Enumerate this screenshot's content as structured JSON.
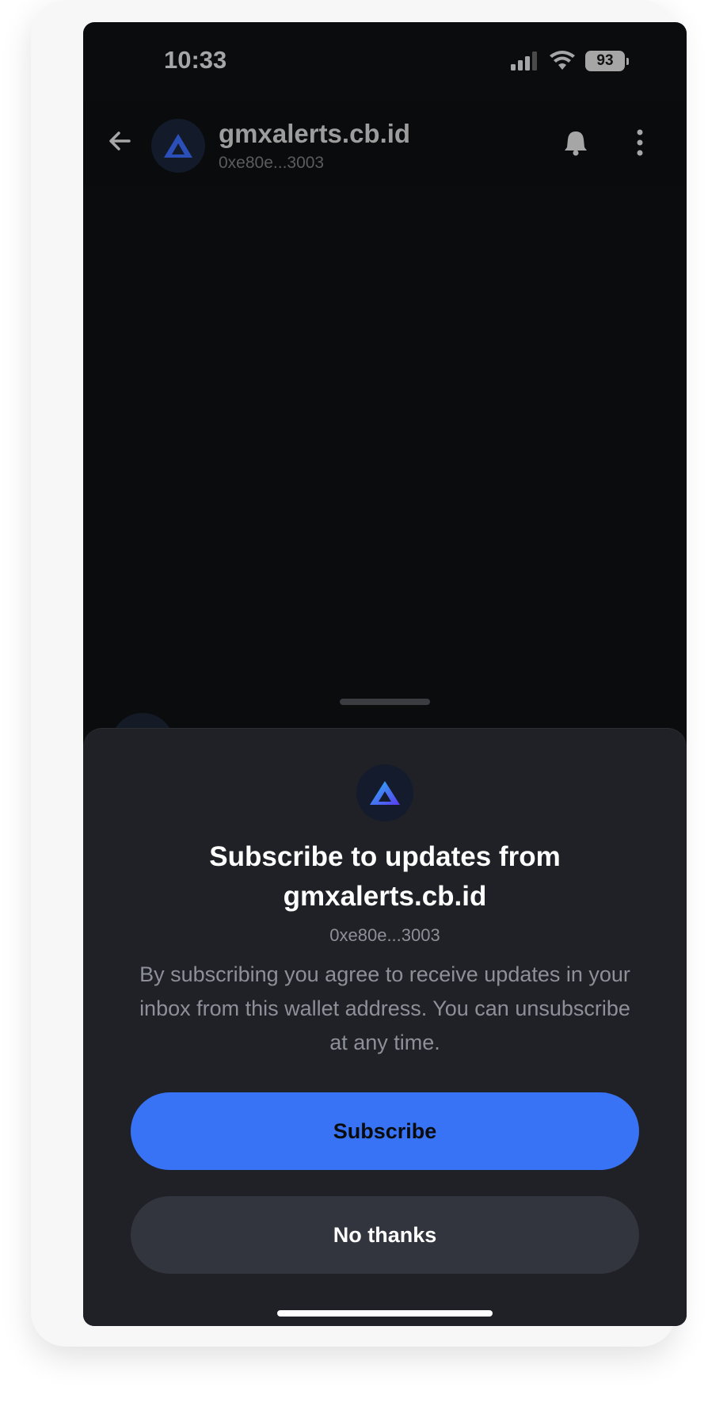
{
  "status_bar": {
    "time": "10:33",
    "battery": "93",
    "icons": [
      "signal-icon",
      "wifi-icon",
      "battery-icon"
    ]
  },
  "header": {
    "title": "gmxalerts.cb.id",
    "subtitle": "0xe80e...3003",
    "icons": [
      "back-arrow-icon",
      "bell-icon",
      "more-vertical-icon"
    ]
  },
  "sheet": {
    "title": "Subscribe to updates from gmxalerts.cb.id",
    "address": "0xe80e...3003",
    "body": "By subscribing you agree to receive updates in your inbox from this wallet address. You can unsubscribe at any time.",
    "subscribe_label": "Subscribe",
    "no_thanks_label": "No thanks"
  },
  "colors": {
    "accent": "#3773f4",
    "sheet_bg": "#202126",
    "screen_bg": "#0b0c0e",
    "secondary_button": "#32353e"
  }
}
